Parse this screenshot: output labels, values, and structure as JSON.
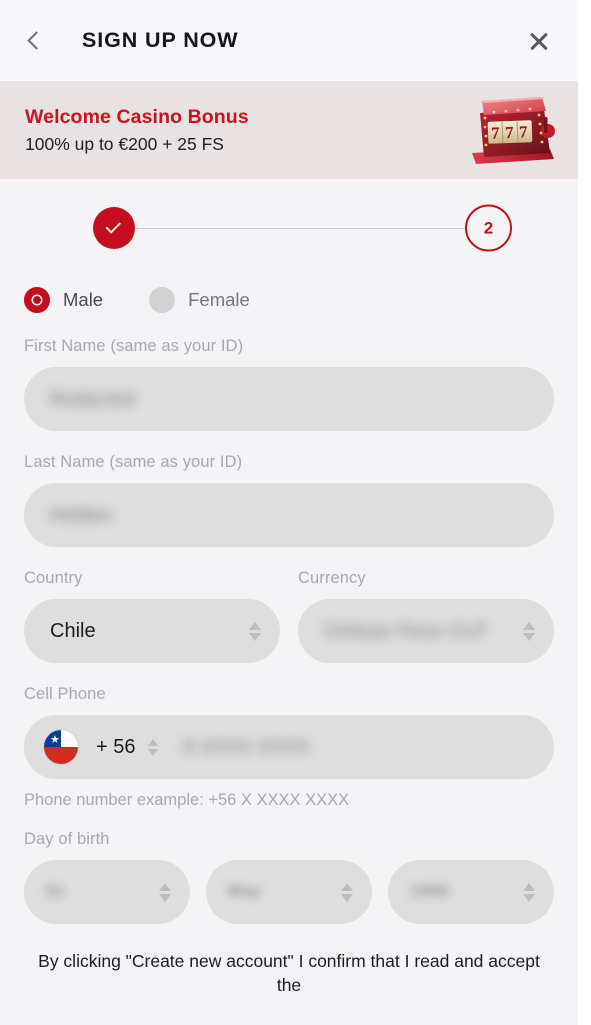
{
  "header": {
    "title": "SIGN UP NOW",
    "back_icon": "chevron-left-icon",
    "close_icon": "close-icon"
  },
  "bonus": {
    "title": "Welcome Casino Bonus",
    "subtitle": "100% up to €200 + 25 FS",
    "icon": "slot-machine-icon",
    "icon_symbol": "777",
    "accent_color": "#cc1122",
    "background": "#e8e3e2"
  },
  "stepper": {
    "step1_state": "completed",
    "step1_icon": "check-icon",
    "step2_label": "2",
    "step2_state": "current",
    "accent_color": "#c40d1e"
  },
  "form": {
    "gender": {
      "selected": "Male",
      "options": [
        {
          "label": "Male",
          "selected": true
        },
        {
          "label": "Female",
          "selected": false
        }
      ]
    },
    "first_name": {
      "label": "First Name (same as your ID)",
      "value": "Redacted",
      "redacted": true
    },
    "last_name": {
      "label": "Last Name (same as your ID)",
      "value": "Hidden",
      "redacted": true
    },
    "country": {
      "label": "Country",
      "value": "Chile",
      "redacted": false
    },
    "currency": {
      "label": "Currency",
      "value": "Chilean Peso  CLP",
      "redacted": true
    },
    "cell_phone": {
      "label": "Cell Phone",
      "flag": "chile-flag-icon",
      "dial_code": "+ 56",
      "number": "9 XXXX XXXX",
      "number_redacted": true,
      "hint": "Phone number example: +56 X XXXX XXXX"
    },
    "day_of_birth": {
      "label": "Day of birth",
      "day": {
        "value": "01",
        "redacted": true
      },
      "month": {
        "value": "May",
        "redacted": true
      },
      "year": {
        "value": "1990",
        "redacted": true
      }
    }
  },
  "terms": {
    "text": "By clicking \"Create new account\" I confirm that I read and accept the"
  },
  "theme": {
    "page_background": "#f4f4f6",
    "header_background": "#f7f7f9",
    "field_background": "#dededf",
    "label_color": "#a7a7ad",
    "accent_red": "#c40d1e"
  }
}
